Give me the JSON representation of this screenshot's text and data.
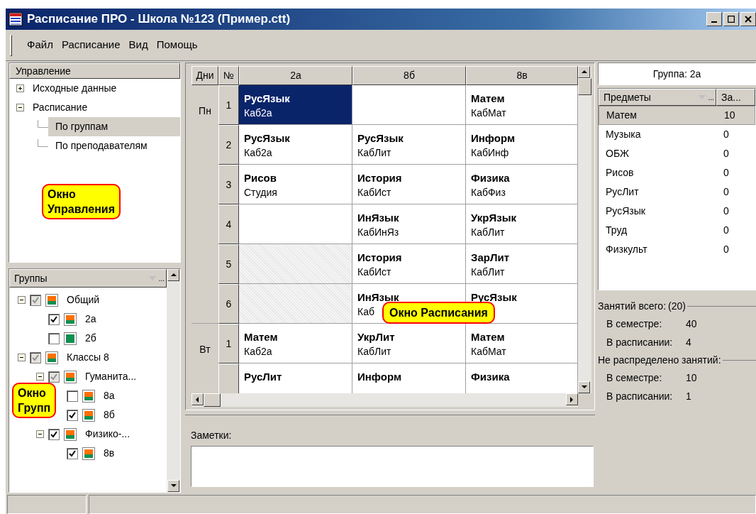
{
  "window": {
    "title": "Расписание ПРО - Школа №123 (Пример.ctt)"
  },
  "menu": [
    {
      "label": "Файл"
    },
    {
      "label": "Расписание"
    },
    {
      "label": "Вид"
    },
    {
      "label": "Помощь"
    }
  ],
  "control_panel": {
    "header": "Управление",
    "items": [
      {
        "label": "Исходные данные",
        "expanded": false,
        "selected": false
      },
      {
        "label": "Расписание",
        "expanded": true,
        "selected": false,
        "children": [
          {
            "label": "По группам",
            "selected": true
          },
          {
            "label": "По преподавателям",
            "selected": false
          }
        ]
      }
    ],
    "callout": "Окно\nУправления"
  },
  "groups_panel": {
    "header": "Группы",
    "header_more": "...",
    "items": [
      {
        "label": "Общий",
        "checked": true,
        "indeterminate": true,
        "kind": "striped",
        "expanded": true,
        "children": [
          {
            "label": "2а",
            "checked": true,
            "indeterminate": false,
            "kind": "striped"
          },
          {
            "label": "2б",
            "checked": false,
            "indeterminate": false,
            "kind": "solid"
          }
        ]
      },
      {
        "label": "Классы 8",
        "checked": true,
        "indeterminate": true,
        "kind": "striped",
        "expanded": true,
        "children": [
          {
            "label": "Гуманита...",
            "checked": true,
            "indeterminate": true,
            "kind": "striped",
            "expanded": true,
            "children": [
              {
                "label": "8а",
                "checked": false,
                "indeterminate": false,
                "kind": "striped"
              },
              {
                "label": "8б",
                "checked": true,
                "indeterminate": false,
                "kind": "striped"
              }
            ]
          },
          {
            "label": "Физико-...",
            "checked": true,
            "indeterminate": false,
            "kind": "striped",
            "expanded": true,
            "children": [
              {
                "label": "8в",
                "checked": true,
                "indeterminate": false,
                "kind": "striped"
              }
            ]
          }
        ]
      }
    ],
    "callout": "Окно\nГрупп"
  },
  "schedule": {
    "columns": [
      "Дни",
      "№",
      "2а",
      "8б",
      "8в"
    ],
    "callout": "Окно Расписания",
    "days": [
      {
        "label": "Пн",
        "lessons": [
          {
            "number": "1",
            "cells": [
              {
                "kind": "lesson",
                "subject": "РусЯзык",
                "room": "Каб2а",
                "selected": true
              },
              {
                "kind": "empty",
                "selected": false
              },
              {
                "kind": "lesson",
                "subject": "Матем",
                "room": "КабМат",
                "selected": false
              }
            ]
          },
          {
            "number": "2",
            "cells": [
              {
                "kind": "lesson",
                "subject": "РусЯзык",
                "room": "Каб2а",
                "selected": false
              },
              {
                "kind": "lesson",
                "subject": "РусЯзык",
                "room": "КабЛит",
                "selected": false
              },
              {
                "kind": "lesson",
                "subject": "Информ",
                "room": "КабИнф",
                "selected": false
              }
            ]
          },
          {
            "number": "3",
            "cells": [
              {
                "kind": "lesson",
                "subject": "Рисов",
                "room": "Студия",
                "selected": false
              },
              {
                "kind": "lesson",
                "subject": "История",
                "room": "КабИст",
                "selected": false
              },
              {
                "kind": "lesson",
                "subject": "Физика",
                "room": "КабФиз",
                "selected": false
              }
            ]
          },
          {
            "number": "4",
            "cells": [
              {
                "kind": "empty",
                "selected": false
              },
              {
                "kind": "lesson",
                "subject": "ИнЯзык",
                "room": "КабИнЯз",
                "selected": false
              },
              {
                "kind": "lesson",
                "subject": "УкрЯзык",
                "room": "КабЛит",
                "selected": false
              }
            ]
          },
          {
            "number": "5",
            "cells": [
              {
                "kind": "blocked",
                "selected": false
              },
              {
                "kind": "lesson",
                "subject": "История",
                "room": "КабИст",
                "selected": false
              },
              {
                "kind": "lesson",
                "subject": "ЗарЛит",
                "room": "КабЛит",
                "selected": false
              }
            ]
          },
          {
            "number": "6",
            "cells": [
              {
                "kind": "blocked",
                "selected": false
              },
              {
                "kind": "lesson",
                "subject": "ИнЯзык",
                "room": "Каб",
                "selected": false
              },
              {
                "kind": "lesson",
                "subject": "РусЯзык",
                "selected": false
              }
            ]
          }
        ]
      },
      {
        "label": "Вт",
        "lessons": [
          {
            "number": "1",
            "cells": [
              {
                "kind": "lesson",
                "subject": "Матем",
                "room": "Каб2а",
                "selected": false
              },
              {
                "kind": "lesson",
                "subject": "УкрЛит",
                "room": "КабЛит",
                "selected": false
              },
              {
                "kind": "lesson",
                "subject": "Матем",
                "room": "КабМат",
                "selected": false
              }
            ]
          },
          {
            "cells": [
              {
                "kind": "lesson",
                "subject": "РусЛит",
                "selected": false
              },
              {
                "kind": "lesson",
                "subject": "Информ",
                "selected": false
              },
              {
                "kind": "lesson",
                "subject": "Физика",
                "selected": false
              }
            ]
          }
        ]
      }
    ]
  },
  "notes": {
    "label": "Заметки:"
  },
  "group_info": {
    "title": "Группа: 2а",
    "columns": [
      "Предметы",
      "За..."
    ],
    "header_more": "...",
    "rows": [
      {
        "subject": "Матем",
        "count": "10",
        "selected": true
      },
      {
        "subject": "Музыка",
        "count": "0",
        "selected": false
      },
      {
        "subject": "ОБЖ",
        "count": "0",
        "selected": false
      },
      {
        "subject": "Рисов",
        "count": "0",
        "selected": false
      },
      {
        "subject": "РусЛит",
        "count": "0",
        "selected": false
      },
      {
        "subject": "РусЯзык",
        "count": "0",
        "selected": false
      },
      {
        "subject": "Труд",
        "count": "0",
        "selected": false
      },
      {
        "subject": "Физкульт",
        "count": "0",
        "selected": false
      }
    ],
    "stats": [
      {
        "legend": "Занятий всего:",
        "total": "(20)",
        "items": [
          {
            "label": "В семестре:",
            "value": "40"
          },
          {
            "label": "В расписании:",
            "value": "4"
          }
        ]
      },
      {
        "legend": "Не распределено занятий:",
        "items": [
          {
            "label": "В семестре:",
            "value": "10"
          },
          {
            "label": "В расписании:",
            "value": "1"
          }
        ]
      }
    ]
  }
}
